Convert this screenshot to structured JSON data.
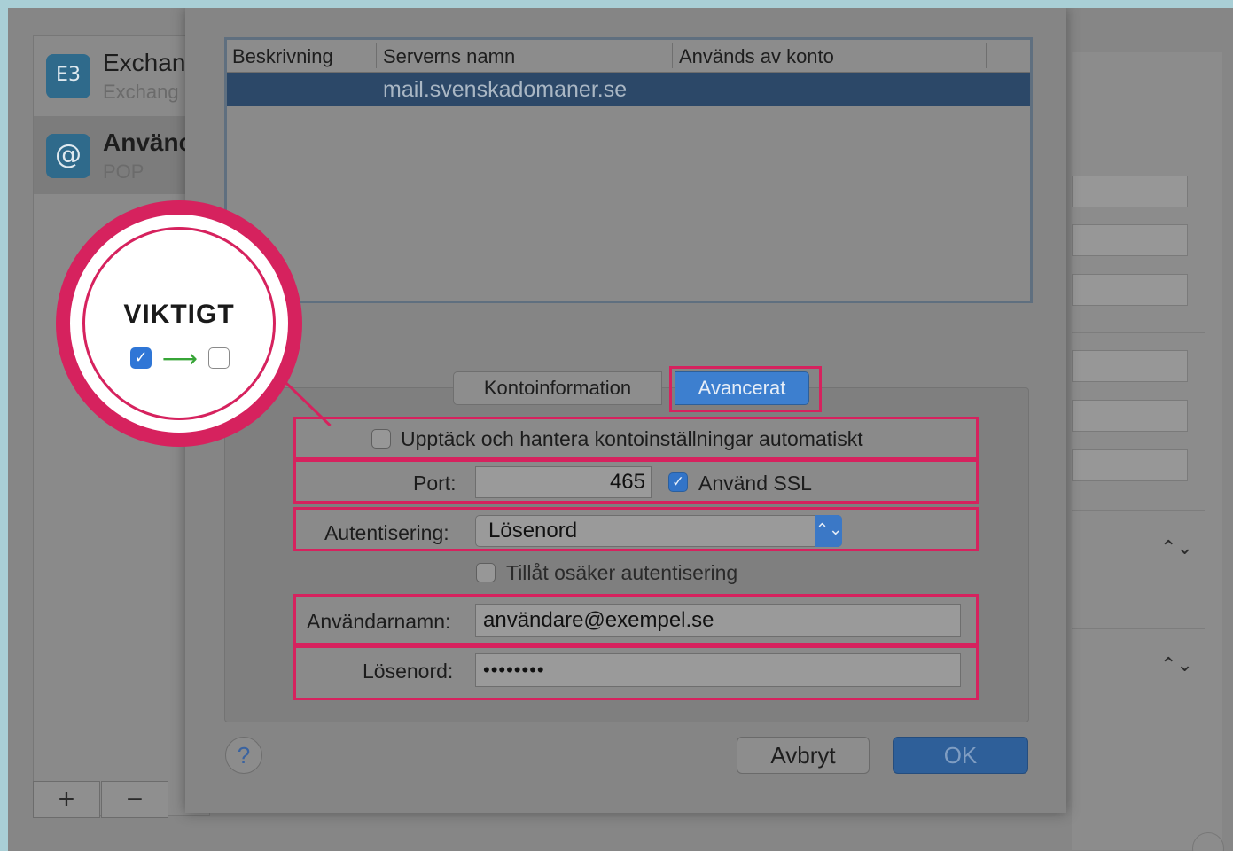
{
  "sidebar": {
    "accounts": [
      {
        "name": "Exchan",
        "subtitle": "Exchang",
        "icon": "exchange-icon",
        "glyph": "E3"
      },
      {
        "name": "Använc",
        "subtitle": "POP",
        "icon": "at-sign-icon",
        "glyph": "@"
      }
    ],
    "add_label": "+",
    "remove_label": "−"
  },
  "background": {
    "stepper_glyph": "⌃⌄"
  },
  "server_table": {
    "columns": [
      "Beskrivning",
      "Serverns namn",
      "Används av konto"
    ],
    "rows": [
      {
        "description": "",
        "server_name": "mail.svenskadomaner.se",
        "used_by": ""
      }
    ]
  },
  "tabs": {
    "account_info": "Kontoinformation",
    "advanced": "Avancerat",
    "selected": "Avancerat"
  },
  "advanced": {
    "auto_detect_label": "Upptäck och hantera kontoinställningar automatiskt",
    "auto_detect_checked": false,
    "port_label": "Port:",
    "port_value": "465",
    "ssl_label": "Använd SSL",
    "ssl_checked": true,
    "auth_label": "Autentisering:",
    "auth_value": "Lösenord",
    "insecure_auth_label": "Tillåt osäker autentisering",
    "insecure_auth_checked": false,
    "username_label": "Användarnamn:",
    "username_value": "användare@exempel.se",
    "password_label": "Lösenord:",
    "password_value": "••••••••"
  },
  "buttons": {
    "help": "?",
    "cancel": "Avbryt",
    "ok": "OK"
  },
  "callout": {
    "title": "VIKTIGT",
    "check_glyph": "✓",
    "arrow_glyph": "⟶"
  },
  "colors": {
    "highlight": "#d6225e",
    "accent_blue": "#3d7fcf",
    "selected_row": "#2c4868"
  }
}
